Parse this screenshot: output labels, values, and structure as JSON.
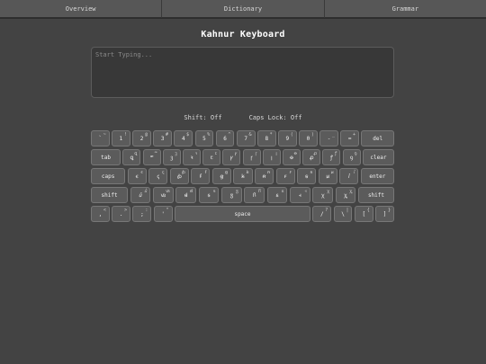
{
  "nav": {
    "tabs": [
      {
        "label": "Overview"
      },
      {
        "label": "Dictionary"
      },
      {
        "label": "Grammar"
      }
    ]
  },
  "title": "Kahnur Keyboard",
  "input": {
    "placeholder": "Start Typing..."
  },
  "status": {
    "shift": "Shift: Off",
    "caps": "Caps Lock: Off"
  },
  "keyboard": {
    "rows": [
      [
        {
          "id": "backtick",
          "label": "`",
          "sup": "~"
        },
        {
          "id": "1",
          "label": "1",
          "sup": "!"
        },
        {
          "id": "2",
          "label": "2",
          "sup": "@"
        },
        {
          "id": "3",
          "label": "3",
          "sup": "#"
        },
        {
          "id": "4",
          "label": "4",
          "sup": "$"
        },
        {
          "id": "5",
          "label": "5",
          "sup": "%"
        },
        {
          "id": "6",
          "label": "6",
          "sup": "^"
        },
        {
          "id": "7",
          "label": "7",
          "sup": "&"
        },
        {
          "id": "8",
          "label": "8",
          "sup": "*"
        },
        {
          "id": "9",
          "label": "9",
          "sup": "("
        },
        {
          "id": "0",
          "label": "0",
          "sup": ")"
        },
        {
          "id": "minus",
          "label": "-",
          "sup": "_"
        },
        {
          "id": "equals",
          "label": "=",
          "sup": "+"
        },
        {
          "id": "del",
          "label": "del",
          "sup": ""
        }
      ],
      [
        {
          "id": "tab",
          "label": "tab",
          "sup": ""
        },
        {
          "id": "q",
          "label": "ꝗ",
          "sup": "ꝗ"
        },
        {
          "id": "w",
          "label": "ꟹ",
          "sup": "ꟹ"
        },
        {
          "id": "e",
          "label": "ꝫ",
          "sup": "ꝫ"
        },
        {
          "id": "r",
          "label": "ꝛ",
          "sup": "ꝛ"
        },
        {
          "id": "t",
          "label": "ꞇ",
          "sup": "ꞇ"
        },
        {
          "id": "y",
          "label": "ꝩ",
          "sup": "ꝩ"
        },
        {
          "id": "u",
          "label": "ꞅ",
          "sup": "ꞅ"
        },
        {
          "id": "i",
          "label": "ꞁ",
          "sup": "ꞁ"
        },
        {
          "id": "o",
          "label": "ꝋ",
          "sup": "ꝋ"
        },
        {
          "id": "p",
          "label": "ꝓ",
          "sup": "ꝓ"
        },
        {
          "id": "lbr",
          "label": "ꝭ",
          "sup": "ꝭ"
        },
        {
          "id": "rbr",
          "label": "ꝯ",
          "sup": "ꝯ"
        },
        {
          "id": "clear",
          "label": "clear",
          "sup": ""
        }
      ],
      [
        {
          "id": "caps",
          "label": "caps",
          "sup": ""
        },
        {
          "id": "a",
          "label": "ꞓ",
          "sup": "ꞓ"
        },
        {
          "id": "s",
          "label": "ꞔ",
          "sup": "ꞔ"
        },
        {
          "id": "d",
          "label": "ꞗ",
          "sup": "ꞗ"
        },
        {
          "id": "f",
          "label": "ꞙ",
          "sup": "ꞙ"
        },
        {
          "id": "g",
          "label": "ꞡ",
          "sup": "ꞡ"
        },
        {
          "id": "h",
          "label": "ꞣ",
          "sup": "ꞣ"
        },
        {
          "id": "j",
          "label": "ꞥ",
          "sup": "ꞥ"
        },
        {
          "id": "k",
          "label": "ꞧ",
          "sup": "ꞧ"
        },
        {
          "id": "l",
          "label": "ꞩ",
          "sup": "ꞩ"
        },
        {
          "id": "semi",
          "label": "ꞹ",
          "sup": "ꞹ"
        },
        {
          "id": "quote",
          "label": "ꞽ",
          "sup": "ꞽ"
        },
        {
          "id": "enter",
          "label": "enter",
          "sup": ""
        }
      ],
      [
        {
          "id": "shift-l",
          "label": "shift",
          "sup": ""
        },
        {
          "id": "z",
          "label": "ꞿ",
          "sup": "ꞿ"
        },
        {
          "id": "x",
          "label": "ꟃ",
          "sup": "ꟃ"
        },
        {
          "id": "c",
          "label": "ꟈ",
          "sup": "ꟈ"
        },
        {
          "id": "v",
          "label": "ꟊ",
          "sup": "ꟊ"
        },
        {
          "id": "b",
          "label": "ꟑ",
          "sup": "ꟑ"
        },
        {
          "id": "n",
          "label": "ꟗ",
          "sup": "ꟗ"
        },
        {
          "id": "m",
          "label": "ꟙ",
          "sup": "ꟙ"
        },
        {
          "id": "comma",
          "label": "ꟶ",
          "sup": "ꟶ"
        },
        {
          "id": "period",
          "label": "ꭓ",
          "sup": "ꭓ"
        },
        {
          "id": "slash",
          "label": "ꭔ",
          "sup": "ꭔ"
        },
        {
          "id": "shift-r",
          "label": "shift",
          "sup": ""
        }
      ],
      [
        {
          "id": "comma2",
          "label": ",",
          "sup": "<"
        },
        {
          "id": "period2",
          "label": ".",
          "sup": ">"
        },
        {
          "id": "semicolon",
          "label": ";",
          "sup": ":"
        },
        {
          "id": "apostrophe",
          "label": "'",
          "sup": "\""
        },
        {
          "id": "space",
          "label": "space",
          "sup": ""
        },
        {
          "id": "slash2",
          "label": "/",
          "sup": "?"
        },
        {
          "id": "backslash",
          "label": "\\",
          "sup": "|"
        },
        {
          "id": "lbrack",
          "label": "[",
          "sup": "{"
        },
        {
          "id": "rbrack",
          "label": "]",
          "sup": "}"
        }
      ]
    ]
  }
}
